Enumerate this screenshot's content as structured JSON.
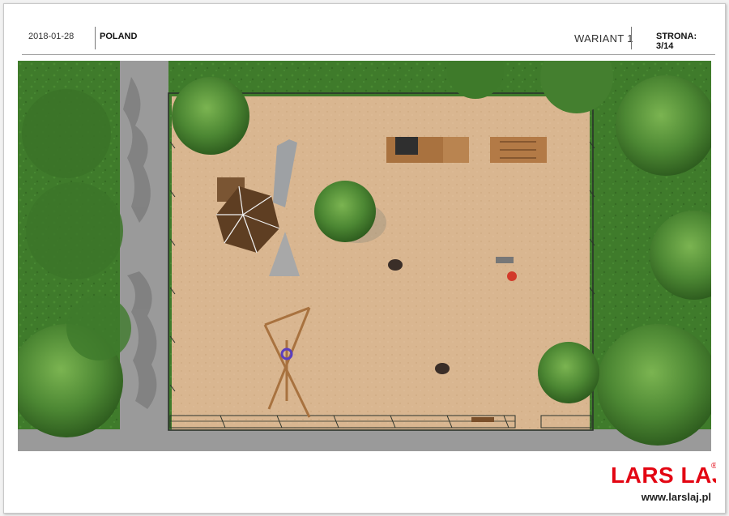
{
  "header": {
    "date": "2018-01-28",
    "project": "POLAND",
    "variant": "WARIANT 1",
    "page": "STRONA: 3/14"
  },
  "brand": {
    "logo_text": "LARS LAJ",
    "registered_mark": "®",
    "website": "www.larslaj.pl",
    "color": "#e30613"
  },
  "scene": {
    "colors": {
      "grass": "#3e7a2a",
      "path": "#9b9b9b",
      "sand": "#d8b58e",
      "fence": "#2f3a2f",
      "wood": "#b07a45",
      "roof": "#6b4a2a",
      "tree": "#4f8a34",
      "swing_seat": "#5b3fbf"
    }
  }
}
